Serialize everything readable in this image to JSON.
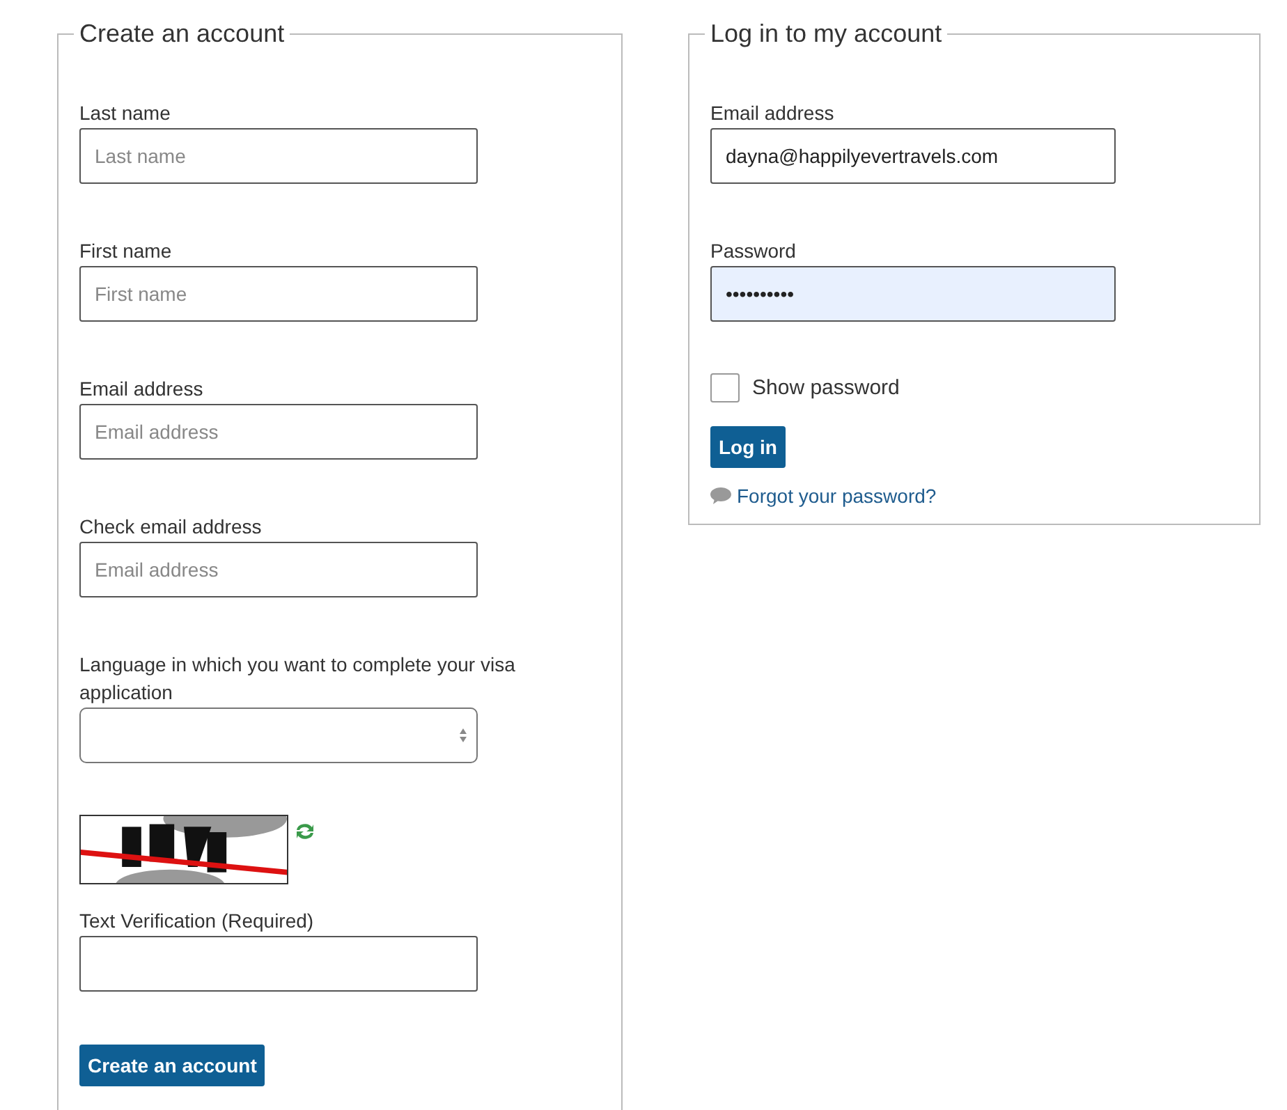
{
  "create_account": {
    "legend": "Create an account",
    "fields": [
      {
        "kind": "text",
        "label": "Last name",
        "placeholder": "Last name"
      },
      {
        "kind": "text",
        "label": "First name",
        "placeholder": "First name"
      },
      {
        "kind": "text",
        "label": "Email address",
        "placeholder": "Email address"
      },
      {
        "kind": "text",
        "label": "Check email address",
        "placeholder": "Email address"
      },
      {
        "kind": "select",
        "label": "Language in which you want to complete your visa application"
      }
    ],
    "verification": {
      "label": "Text Verification (Required)"
    },
    "button": "Create an account"
  },
  "login": {
    "legend": "Log in to my account",
    "email": {
      "label": "Email address",
      "value": "dayna@happilyevertravels.com",
      "focused": false
    },
    "password": {
      "label": "Password",
      "value": "••••••••••",
      "focused": true
    },
    "show_password": {
      "label": "Show password",
      "checked": false
    },
    "button": "Log in",
    "forgot_link": "Forgot your password?"
  }
}
